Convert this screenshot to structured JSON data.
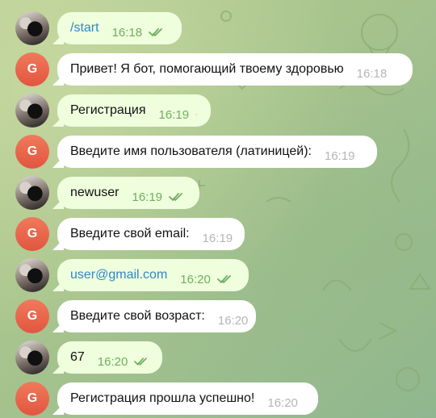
{
  "chat": {
    "messages": [
      {
        "kind": "out",
        "avatar": "user",
        "text": "/start",
        "link": true,
        "time": "16:18"
      },
      {
        "kind": "in",
        "avatar": "bot",
        "avatar_letter": "G",
        "text": "Привет! Я бот, помогающий твоему здоровью",
        "time": "16:18"
      },
      {
        "kind": "out",
        "avatar": "user",
        "text": "Регистрация",
        "link": false,
        "time": "16:19"
      },
      {
        "kind": "in",
        "avatar": "bot",
        "avatar_letter": "G",
        "text": "Введите имя пользователя (латиницей):",
        "time": "16:19"
      },
      {
        "kind": "out",
        "avatar": "user",
        "text": "newuser",
        "link": false,
        "time": "16:19"
      },
      {
        "kind": "in",
        "avatar": "bot",
        "avatar_letter": "G",
        "text": "Введите свой email:",
        "time": "16:19"
      },
      {
        "kind": "out",
        "avatar": "user",
        "text": "user@gmail.com",
        "link": true,
        "time": "16:20"
      },
      {
        "kind": "in",
        "avatar": "bot",
        "avatar_letter": "G",
        "text": "Введите свой возраст:",
        "time": "16:20"
      },
      {
        "kind": "out",
        "avatar": "user",
        "text": "67",
        "link": false,
        "time": "16:20"
      },
      {
        "kind": "in",
        "avatar": "bot",
        "avatar_letter": "G",
        "text": "Регистрация прошла успешно!",
        "time": "16:20"
      }
    ],
    "colors": {
      "incoming_bubble": "#ffffff",
      "outgoing_bubble": "#effedd",
      "link": "#2f87c7",
      "read_checks": "#6fae5f",
      "bot_avatar": "#e2553f"
    },
    "icons": {
      "read_status": "double-check-icon",
      "user_avatar": "user-avatar",
      "bot_avatar": "bot-avatar"
    }
  }
}
